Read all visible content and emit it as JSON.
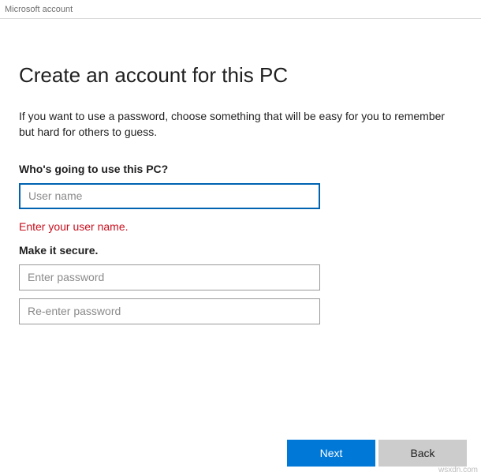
{
  "window": {
    "title": "Microsoft account"
  },
  "page": {
    "heading": "Create an account for this PC",
    "description": "If you want to use a password, choose something that will be easy for you to remember but hard for others to guess."
  },
  "user_section": {
    "label": "Who's going to use this PC?",
    "username_placeholder": "User name",
    "username_value": "",
    "error": "Enter your user name."
  },
  "password_section": {
    "label": "Make it secure.",
    "password_placeholder": "Enter password",
    "password_value": "",
    "confirm_placeholder": "Re-enter password",
    "confirm_value": ""
  },
  "buttons": {
    "next": "Next",
    "back": "Back"
  },
  "watermark": "wsxdn.com"
}
